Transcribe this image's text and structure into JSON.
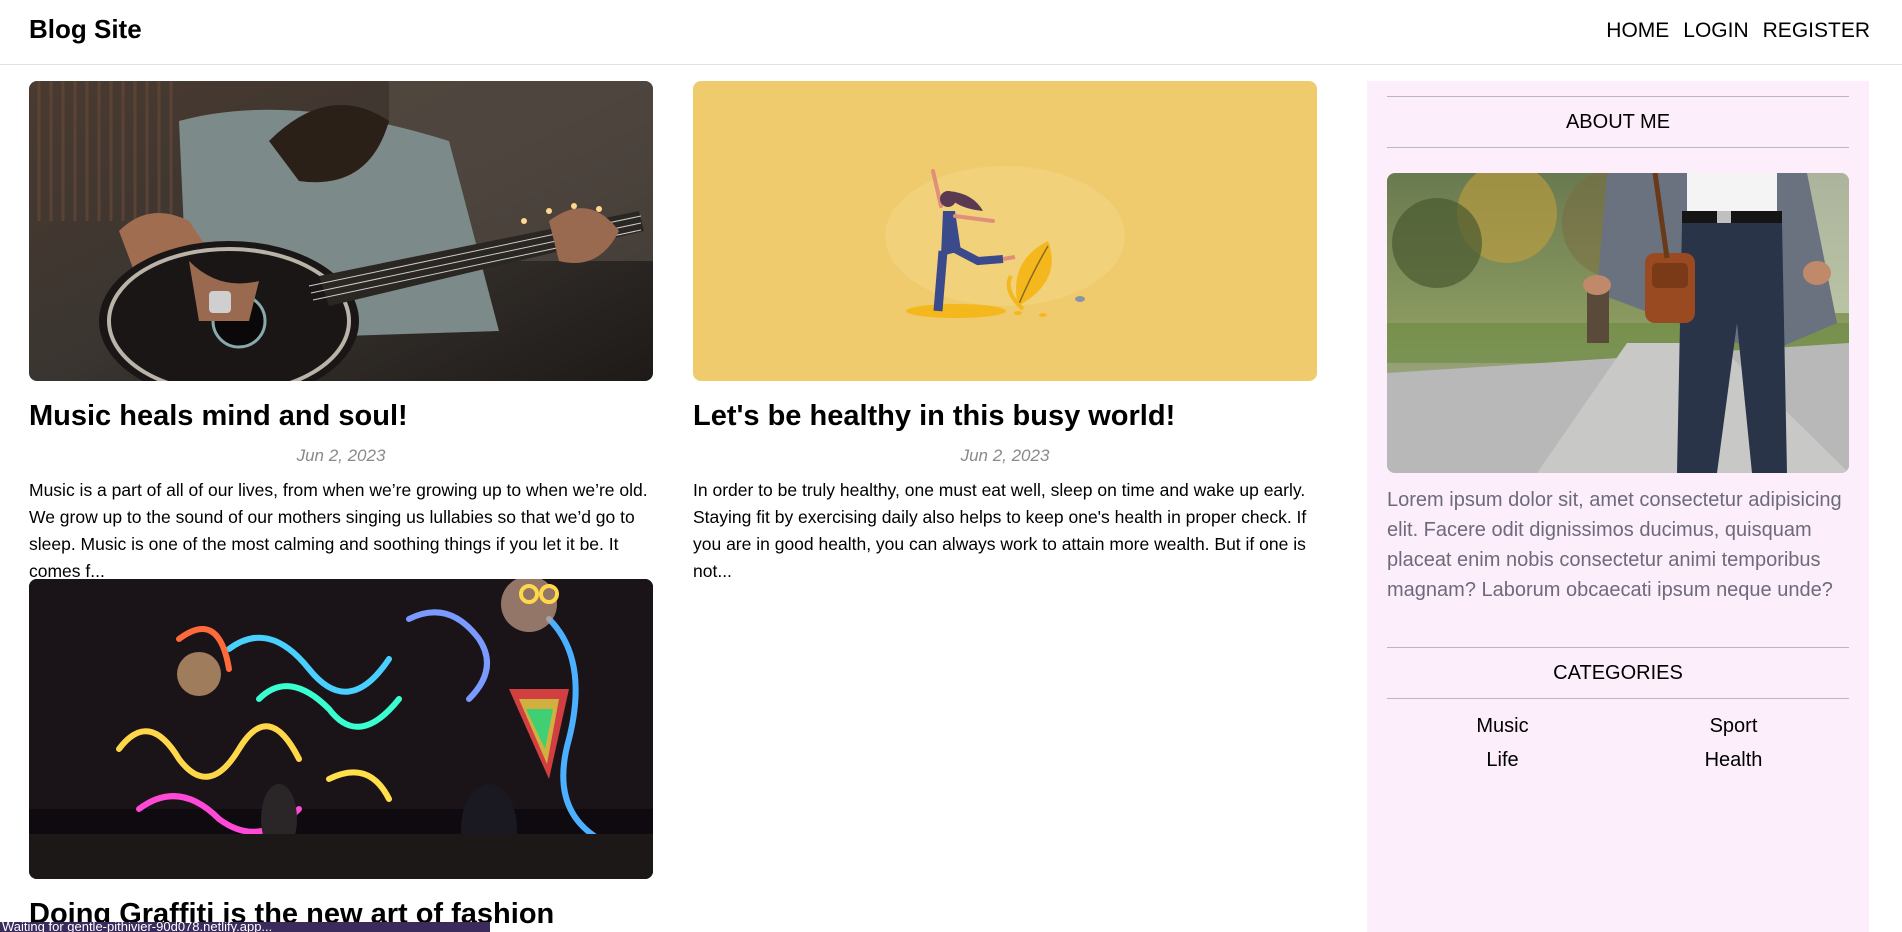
{
  "navbar": {
    "brand": "Blog Site",
    "links": [
      "HOME",
      "LOGIN",
      "REGISTER"
    ]
  },
  "posts": [
    {
      "title": "Music heals mind and soul!",
      "date": "Jun 2, 2023",
      "desc": "Music is a part of all of our lives, from when we’re growing up to when we’re old. We grow up to the sound of our mothers singing us lullabies so that we’d go to sleep. Music is one of the most calming and soothing things if you let it be. It comes f...",
      "image": "man playing acoustic guitar"
    },
    {
      "title": "Let's be healthy in this busy world!",
      "date": "Jun 2, 2023",
      "desc": "In order to be truly healthy, one must eat well, sleep on time and wake up early. Staying fit by exercising daily also helps to keep one's health in proper check. If you are in good health, you can always work to attain more wealth. But if one is not...",
      "image": "illustration of dancing woman"
    },
    {
      "title": "Doing Graffiti is the new art of fashion",
      "image": "neon graffiti light wall"
    }
  ],
  "sidebar": {
    "about_title": "ABOUT ME",
    "about_text": "Lorem ipsum dolor sit, amet consectetur adipisicing elit. Facere odit dignissimos ducimus, quisquam placeat enim nobis consectetur animi temporibus magnam? Laborum obcaecati ipsum neque unde?",
    "categories_title": "CATEGORIES",
    "categories": [
      "Music",
      "Sport",
      "Life",
      "Health"
    ]
  },
  "status": "Waiting for gentle-pithivier-90d078.netlify.app...",
  "colors": {
    "sidebar_bg": "#fdeefb",
    "yellow_card": "#efcb6e",
    "date_gray": "#8a8a8a",
    "status_bar": "#3b2a5c"
  }
}
